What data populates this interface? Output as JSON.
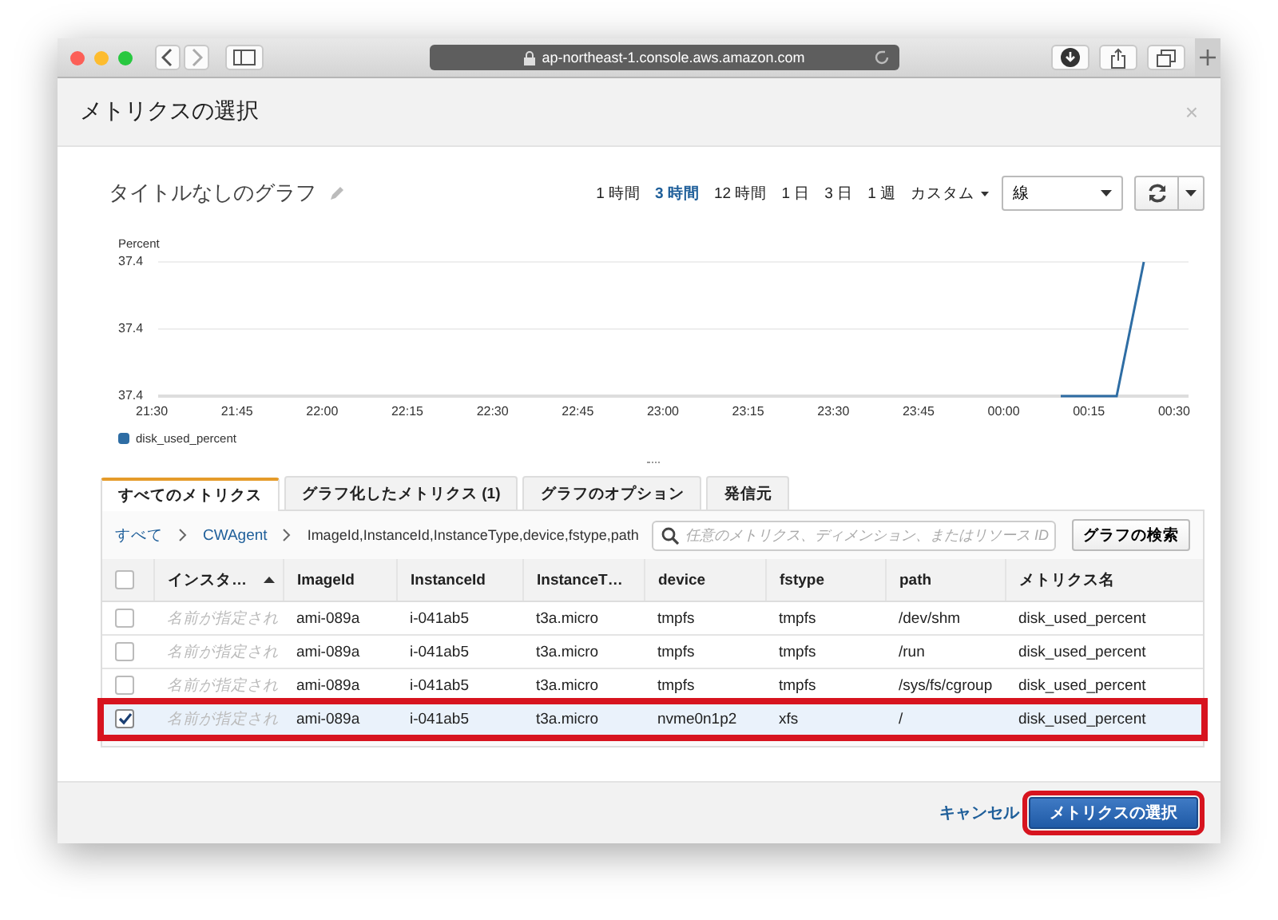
{
  "browser": {
    "url": "ap-northeast-1.console.aws.amazon.com"
  },
  "dialog": {
    "title": "メトリクスの選択",
    "close": "×"
  },
  "graph": {
    "title": "タイトルなしのグラフ",
    "ranges": [
      {
        "label": "1 時間",
        "selected": false,
        "kind": "link"
      },
      {
        "label": "3 時間",
        "selected": true,
        "kind": "link"
      },
      {
        "label": "12 時間",
        "selected": false,
        "kind": "link"
      },
      {
        "label": "1 日",
        "selected": false,
        "kind": "link"
      },
      {
        "label": "3 日",
        "selected": false,
        "kind": "link"
      },
      {
        "label": "1 週",
        "selected": false,
        "kind": "link"
      },
      {
        "label": "カスタム",
        "selected": false,
        "kind": "dropdown"
      }
    ],
    "chart_type": "線",
    "y_label": "Percent",
    "y_ticks": [
      "37.4",
      "37.4",
      "37.4"
    ],
    "x_ticks": [
      "21:30",
      "21:45",
      "22:00",
      "22:15",
      "22:30",
      "22:45",
      "23:00",
      "23:15",
      "23:30",
      "23:45",
      "00:00",
      "00:15",
      "00:30"
    ],
    "legend": "disk_used_percent"
  },
  "tabs": [
    {
      "label": "すべてのメトリクス",
      "selected": true
    },
    {
      "label": "グラフ化したメトリクス (1)",
      "selected": false
    },
    {
      "label": "グラフのオプション",
      "selected": false
    },
    {
      "label": "発信元",
      "selected": false
    }
  ],
  "breadcrumb": [
    {
      "label": "すべて",
      "kind": "link"
    },
    {
      "label": "CWAgent",
      "kind": "link"
    },
    {
      "label": "ImageId,InstanceId,InstanceType,device,fstype,path",
      "kind": "text"
    }
  ],
  "search": {
    "placeholder": "任意のメトリクス、ディメンション、またはリソース ID"
  },
  "search_button": "グラフの検索",
  "table": {
    "select_all": {
      "checked": false
    },
    "columns": [
      {
        "label": "インスタ…",
        "sorted": true
      },
      {
        "label": "ImageId",
        "sorted": false
      },
      {
        "label": "InstanceId",
        "sorted": false
      },
      {
        "label": "InstanceT…",
        "sorted": false
      },
      {
        "label": "device",
        "sorted": false
      },
      {
        "label": "fstype",
        "sorted": false
      },
      {
        "label": "path",
        "sorted": false
      },
      {
        "label": "メトリクス名",
        "sorted": false
      }
    ],
    "rows": [
      {
        "checked": false,
        "highlighted": false,
        "cells": [
          "名前が指定され",
          "ami-089a",
          "i-041ab5",
          "t3a.micro",
          "tmpfs",
          "tmpfs",
          "/dev/shm",
          "disk_used_percent"
        ]
      },
      {
        "checked": false,
        "highlighted": false,
        "cells": [
          "名前が指定され",
          "ami-089a",
          "i-041ab5",
          "t3a.micro",
          "tmpfs",
          "tmpfs",
          "/run",
          "disk_used_percent"
        ]
      },
      {
        "checked": false,
        "highlighted": false,
        "cells": [
          "名前が指定され",
          "ami-089a",
          "i-041ab5",
          "t3a.micro",
          "tmpfs",
          "tmpfs",
          "/sys/fs/cgroup",
          "disk_used_percent"
        ]
      },
      {
        "checked": true,
        "highlighted": true,
        "cells": [
          "名前が指定され",
          "ami-089a",
          "i-041ab5",
          "t3a.micro",
          "nvme0n1p2",
          "xfs",
          "/",
          "disk_used_percent"
        ]
      }
    ]
  },
  "footer": {
    "cancel": "キャンセル",
    "confirm": {
      "label": "メトリクスの選択",
      "highlighted": true
    }
  }
}
